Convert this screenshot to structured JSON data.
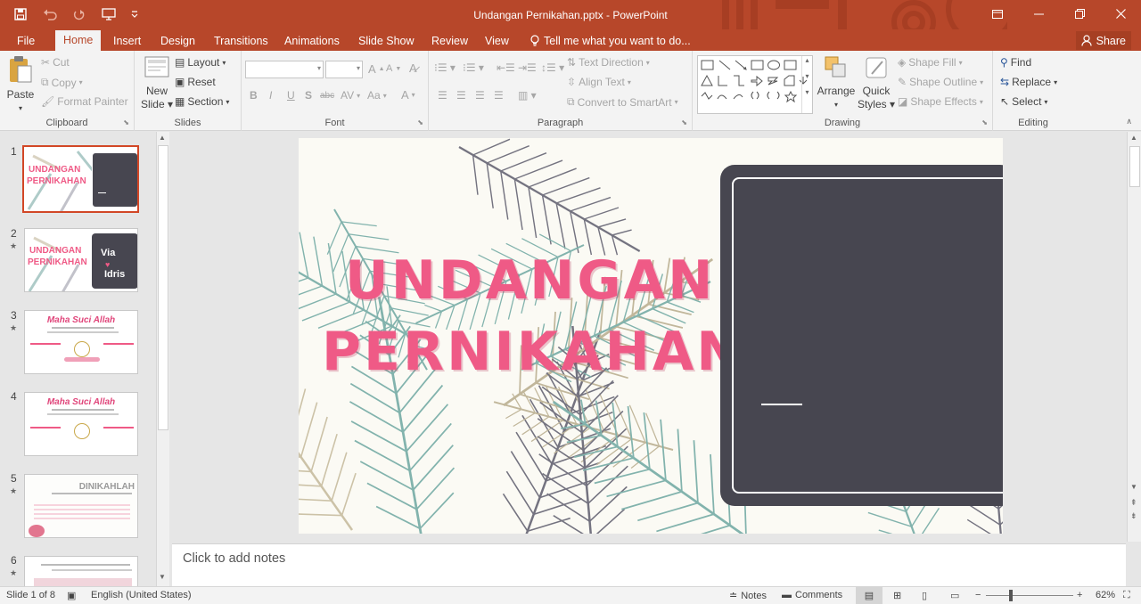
{
  "app": {
    "title": "Undangan Pernikahan.pptx - PowerPoint"
  },
  "tabs": {
    "file": "File",
    "home": "Home",
    "insert": "Insert",
    "design": "Design",
    "transitions": "Transitions",
    "animations": "Animations",
    "slideshow": "Slide Show",
    "review": "Review",
    "view": "View"
  },
  "tellme": "Tell me what you want to do...",
  "share": "Share",
  "ribbon": {
    "clipboard": {
      "label": "Clipboard",
      "paste": "Paste",
      "cut": "Cut",
      "copy": "Copy",
      "format_painter": "Format Painter"
    },
    "slides": {
      "label": "Slides",
      "new_slide_1": "New",
      "new_slide_2": "Slide",
      "layout": "Layout",
      "reset": "Reset",
      "section": "Section"
    },
    "font": {
      "label": "Font",
      "bold": "B",
      "italic": "I",
      "underline": "U",
      "shadow": "S",
      "strike": "abc",
      "spacing": "AV",
      "case": "Aa",
      "color": "A"
    },
    "paragraph": {
      "label": "Paragraph",
      "text_direction": "Text Direction",
      "align_text": "Align Text",
      "smartart": "Convert to SmartArt"
    },
    "drawing": {
      "label": "Drawing",
      "arrange": "Arrange",
      "quick_1": "Quick",
      "quick_2": "Styles",
      "shape_fill": "Shape Fill",
      "shape_outline": "Shape Outline",
      "shape_effects": "Shape Effects"
    },
    "editing": {
      "label": "Editing",
      "find": "Find",
      "replace": "Replace",
      "select": "Select"
    }
  },
  "thumbs": [
    {
      "num": "1",
      "title1": "UNDANGAN",
      "title2": "PERNIKAHAN"
    },
    {
      "num": "2",
      "title1": "UNDANGAN",
      "title2": "PERNIKAHAN",
      "name1": "Via",
      "name2": "Idris"
    },
    {
      "num": "3",
      "heading": "Maha Suci Allah"
    },
    {
      "num": "4",
      "heading": "Maha Suci Allah"
    },
    {
      "num": "5",
      "heading": "DINIKAHLAH"
    },
    {
      "num": "6"
    }
  ],
  "slide": {
    "title_line1": "UNDANGAN",
    "title_line2": "PERNIKAHAN"
  },
  "notes_placeholder": "Click to add notes",
  "status": {
    "slide_info": "Slide 1 of 8",
    "language": "English (United States)",
    "notes": "Notes",
    "comments": "Comments",
    "zoom": "62%"
  },
  "colors": {
    "accent": "#b7472a",
    "title_pink": "#ef5a86",
    "panel": "#474650"
  }
}
